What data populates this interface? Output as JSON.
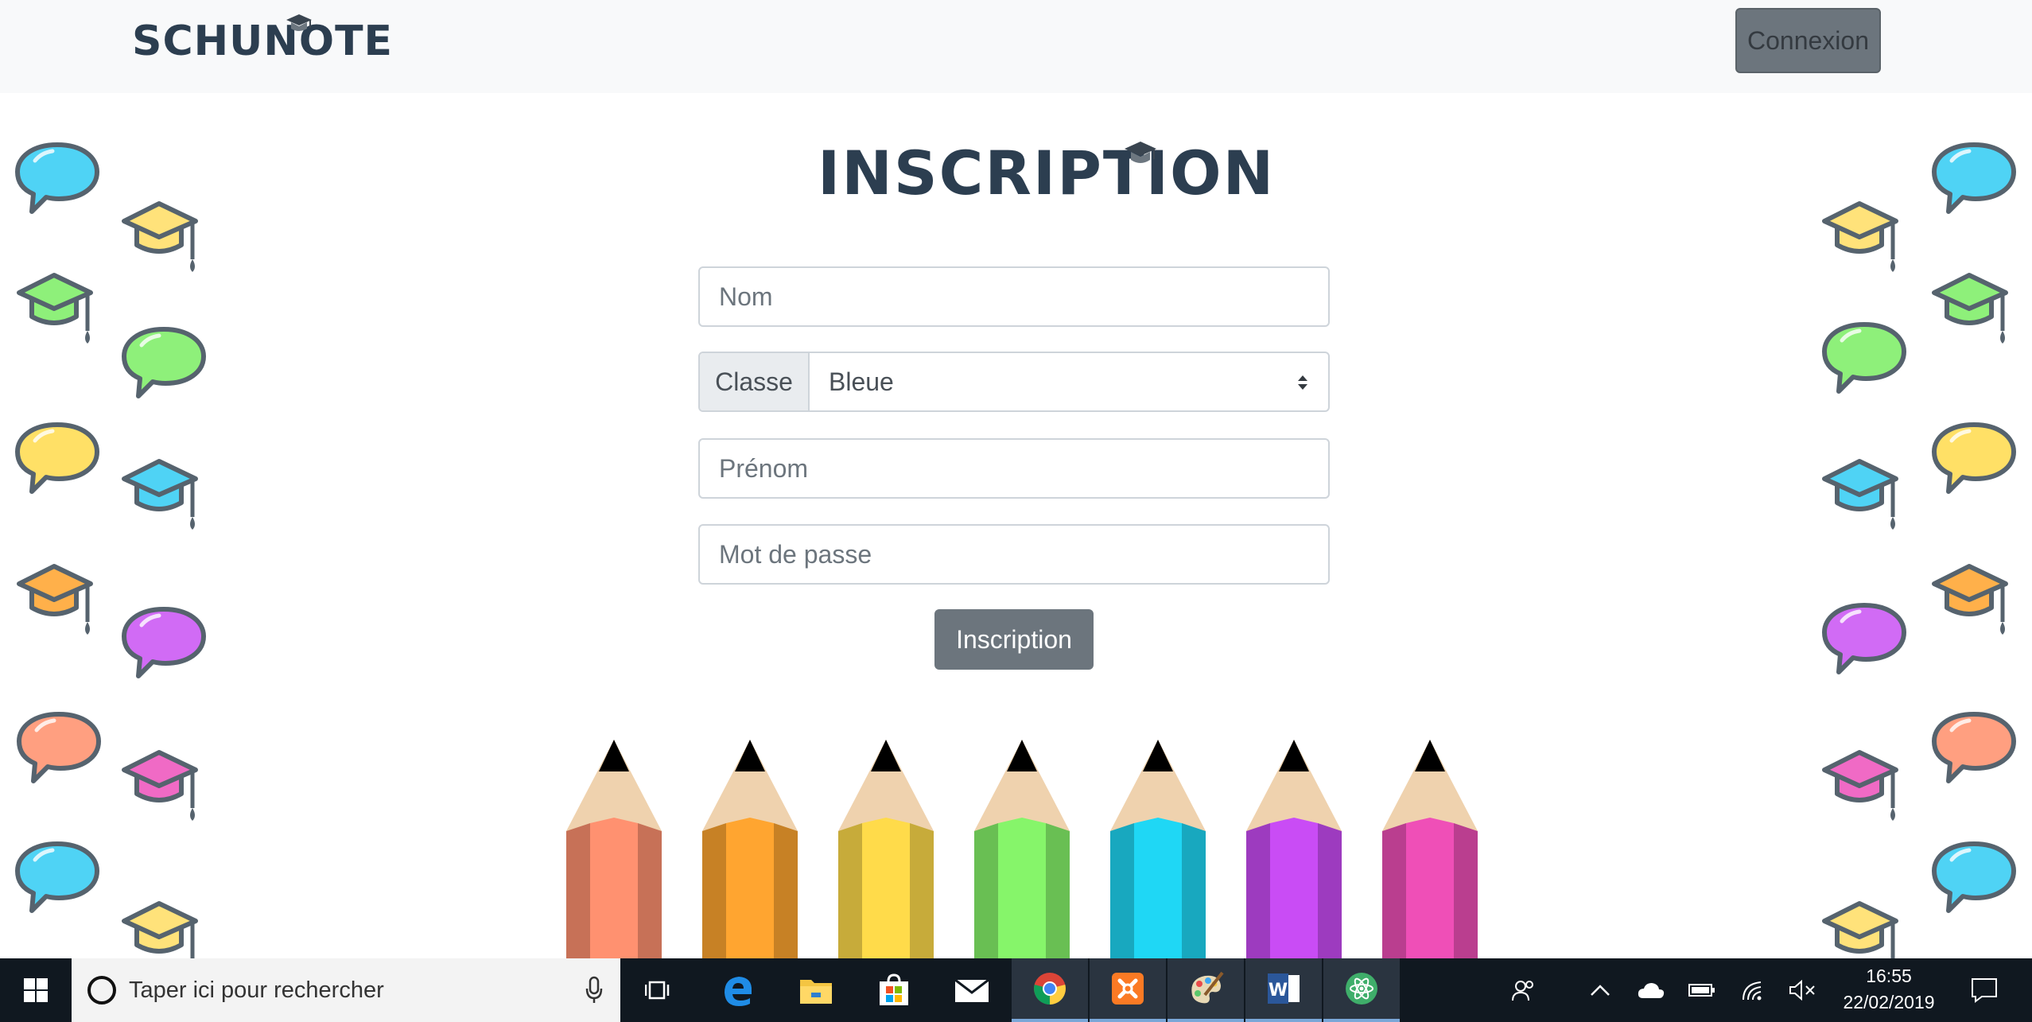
{
  "navbar": {
    "brand": "SCHUNOTE",
    "login_button": "Connexion"
  },
  "form": {
    "title": "INSCRIPTION",
    "nom_placeholder": "Nom",
    "classe_label": "Classe",
    "classe_selected": "Bleue",
    "prenom_placeholder": "Prénom",
    "password_placeholder": "Mot de passe",
    "submit_label": "Inscription"
  },
  "decor": {
    "pencil_colors": [
      "#ff9170",
      "#ffa530",
      "#ffdb4a",
      "#86f56a",
      "#1fd7f5",
      "#c94cf5",
      "#ef4fb7"
    ],
    "bubble_colors": [
      "#4fd3f5",
      "#8ef07a",
      "#ffe066",
      "#d16bf5",
      "#ff9f80"
    ],
    "cap_colors": [
      "#ffe27a",
      "#8ef07a",
      "#4fd3f5",
      "#ffb04a",
      "#f06ac5"
    ]
  },
  "taskbar": {
    "search_placeholder": "Taper ici pour rechercher",
    "apps": [
      "task-view-icon",
      "edge-icon",
      "file-explorer-icon",
      "store-icon",
      "mail-icon",
      "chrome-icon",
      "xampp-icon",
      "paint-icon",
      "word-icon",
      "atom-icon"
    ],
    "time": "16:55",
    "date": "22/02/2019"
  }
}
